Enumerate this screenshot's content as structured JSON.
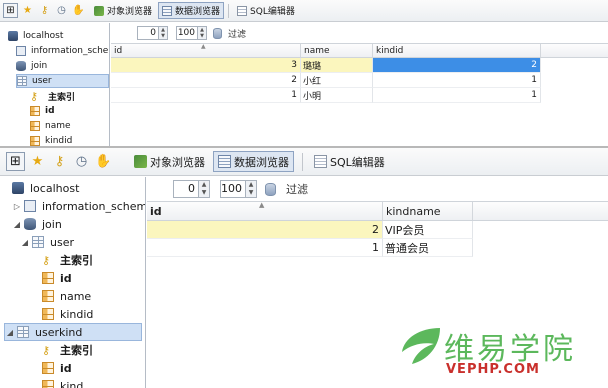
{
  "colors": {
    "accent_selected": "#3d8ee6",
    "row_highlight": "#fbf6be",
    "watermark_green": "#5cb85c",
    "watermark_red": "#c9302c"
  },
  "toolbar": {
    "icons": [
      "tree-toggle-icon",
      "star-icon",
      "key-icon",
      "clock-icon",
      "hand-icon"
    ],
    "object_browser": "对象浏览器",
    "data_browser": "数据浏览器",
    "sql_editor": "SQL编辑器"
  },
  "top": {
    "tree": {
      "host": "localhost",
      "db_info": "information_schem",
      "db_join": "join",
      "table_user": "user",
      "primary_key": "主索引",
      "col_id": "id",
      "col_name": "name",
      "col_kindid": "kindid"
    },
    "nav": {
      "offset": "0",
      "limit": "100",
      "filter": "过滤"
    },
    "columns": [
      "id",
      "name",
      "kindid"
    ],
    "rows": [
      {
        "id": "3",
        "name": "璐璐",
        "kindid": "2"
      },
      {
        "id": "2",
        "name": "小红",
        "kindid": "1"
      },
      {
        "id": "1",
        "name": "小明",
        "kindid": "1"
      }
    ]
  },
  "bottom": {
    "tree": {
      "host": "localhost",
      "db_info": "information_schem",
      "db_join": "join",
      "table_user": "user",
      "primary_key": "主索引",
      "col_id": "id",
      "col_name": "name",
      "col_kindid": "kindid",
      "table_userkind": "userkind",
      "primary_key_2": "主索引",
      "col_id_2": "id",
      "col_cut": "kind"
    },
    "nav": {
      "offset": "0",
      "limit": "100",
      "filter": "过滤"
    },
    "columns": [
      "id",
      "kindname"
    ],
    "rows": [
      {
        "id": "2",
        "kindname": "VIP会员"
      },
      {
        "id": "1",
        "kindname": "普通会员"
      }
    ]
  },
  "watermark": {
    "title": "维易学院",
    "subtitle": "VEPHP.COM"
  }
}
